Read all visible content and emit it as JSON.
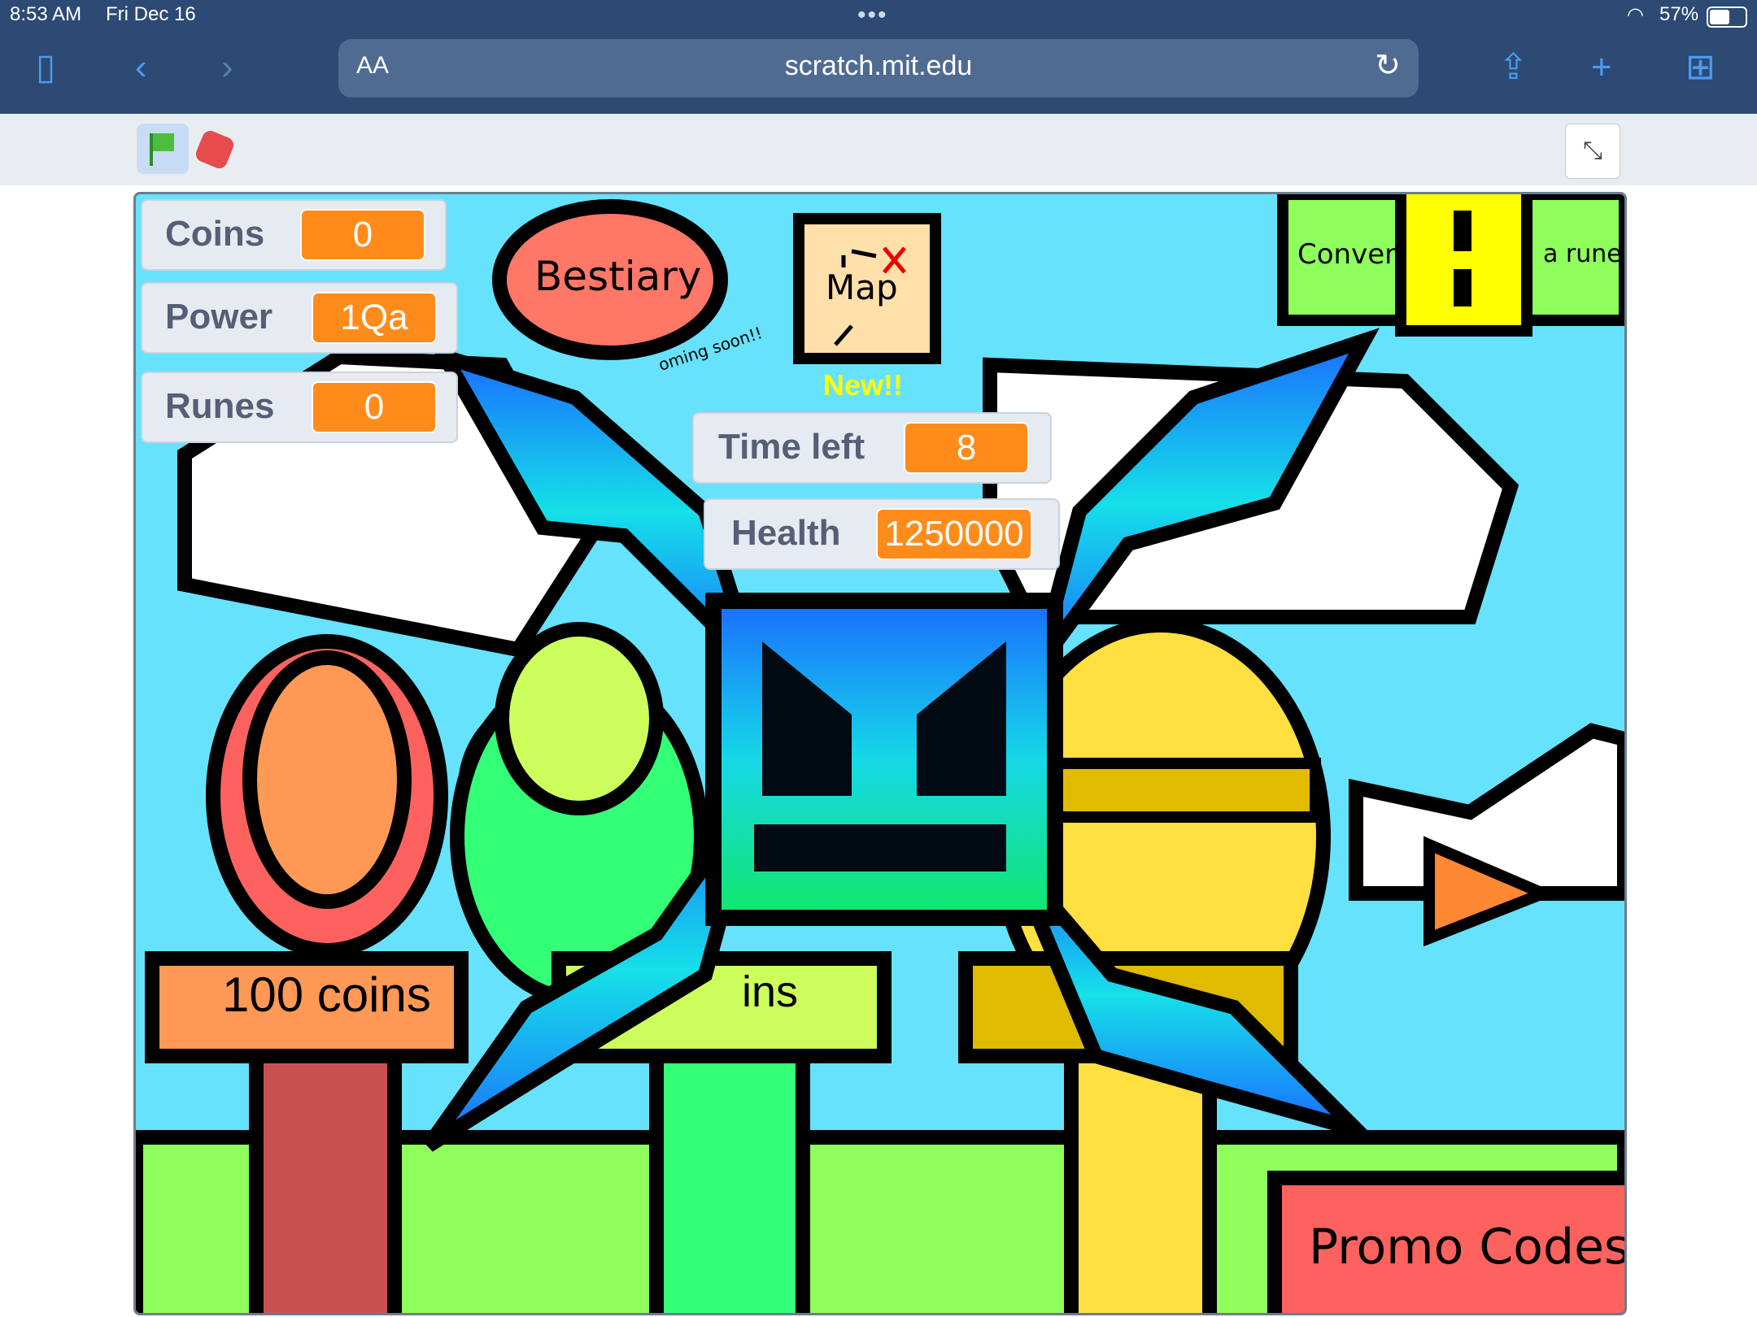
{
  "status_bar": {
    "time": "8:53 AM",
    "date": "Fri Dec 16",
    "battery": "57%"
  },
  "browser": {
    "aa_label": "AA",
    "url": "scratch.mit.edu"
  },
  "monitors": {
    "coins": {
      "label": "Coins",
      "value": "0"
    },
    "power": {
      "label": "Power",
      "value": "1Qa"
    },
    "runes": {
      "label": "Runes",
      "value": "0"
    },
    "time_left": {
      "label": "Time left",
      "value": "8"
    },
    "health": {
      "label": "Health",
      "value": "1250000"
    }
  },
  "game": {
    "bestiary": "Bestiary",
    "coming_soon": "oming soon!!",
    "map": "Map",
    "new_badge": "New!!",
    "convert_left": "Convert",
    "convert_right": "a rune",
    "coins_sign": "100 coins",
    "green_sign": "ins",
    "promo_codes": "Promo Codes"
  },
  "colors": {
    "sky": "#66e2fc",
    "grass": "#8eff5c",
    "monitor_value": "#ff8c1a",
    "chrome": "#2c4a73"
  }
}
